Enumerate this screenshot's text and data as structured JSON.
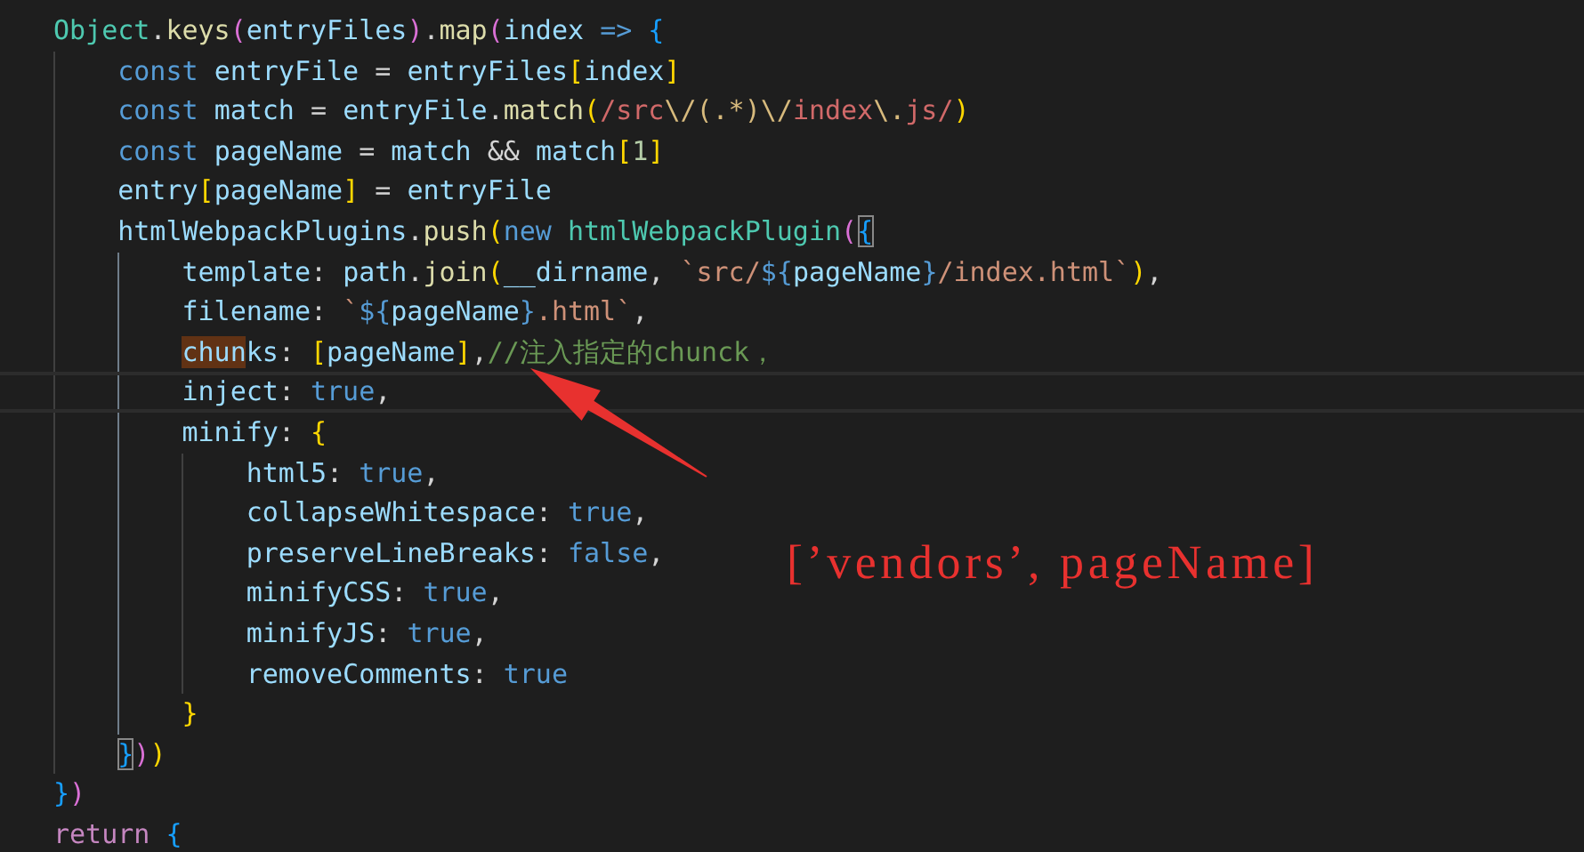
{
  "editor": {
    "lines": [
      {
        "current": false,
        "tokens": [
          {
            "text": "Object",
            "kind": "type"
          },
          {
            "text": ".",
            "kind": "plain"
          },
          {
            "text": "keys",
            "kind": "fn"
          },
          {
            "text": "(",
            "kind": "b2"
          },
          {
            "text": "entryFiles",
            "kind": "var"
          },
          {
            "text": ")",
            "kind": "b2"
          },
          {
            "text": ".",
            "kind": "plain"
          },
          {
            "text": "map",
            "kind": "fn"
          },
          {
            "text": "(",
            "kind": "b2"
          },
          {
            "text": "index",
            "kind": "var"
          },
          {
            "text": " => ",
            "kind": "kw"
          },
          {
            "text": "{",
            "kind": "b3"
          }
        ]
      },
      {
        "current": false,
        "tokens": [
          {
            "text": "    const",
            "kind": "kw"
          },
          {
            "text": " entryFile",
            "kind": "var"
          },
          {
            "text": " = ",
            "kind": "plain"
          },
          {
            "text": "entryFiles",
            "kind": "var"
          },
          {
            "text": "[",
            "kind": "b1"
          },
          {
            "text": "index",
            "kind": "var"
          },
          {
            "text": "]",
            "kind": "b1"
          }
        ]
      },
      {
        "current": false,
        "tokens": [
          {
            "text": "    const",
            "kind": "kw"
          },
          {
            "text": " match",
            "kind": "var"
          },
          {
            "text": " = ",
            "kind": "plain"
          },
          {
            "text": "entryFile",
            "kind": "var"
          },
          {
            "text": ".",
            "kind": "plain"
          },
          {
            "text": "match",
            "kind": "fn"
          },
          {
            "text": "(",
            "kind": "b1"
          },
          {
            "text": "/src",
            "kind": "regex"
          },
          {
            "text": "\\/(.*)\\/",
            "kind": "esc"
          },
          {
            "text": "index",
            "kind": "regex"
          },
          {
            "text": "\\.",
            "kind": "esc"
          },
          {
            "text": "js/",
            "kind": "regex"
          },
          {
            "text": ")",
            "kind": "b1"
          }
        ]
      },
      {
        "current": false,
        "tokens": [
          {
            "text": "    const",
            "kind": "kw"
          },
          {
            "text": " pageName",
            "kind": "var"
          },
          {
            "text": " = ",
            "kind": "plain"
          },
          {
            "text": "match",
            "kind": "var"
          },
          {
            "text": " && ",
            "kind": "plain"
          },
          {
            "text": "match",
            "kind": "var"
          },
          {
            "text": "[",
            "kind": "b1"
          },
          {
            "text": "1",
            "kind": "num"
          },
          {
            "text": "]",
            "kind": "b1"
          }
        ]
      },
      {
        "current": false,
        "tokens": [
          {
            "text": "    entry",
            "kind": "var"
          },
          {
            "text": "[",
            "kind": "b1"
          },
          {
            "text": "pageName",
            "kind": "var"
          },
          {
            "text": "]",
            "kind": "b1"
          },
          {
            "text": " = ",
            "kind": "plain"
          },
          {
            "text": "entryFile",
            "kind": "var"
          }
        ]
      },
      {
        "current": false,
        "tokens": [
          {
            "text": "    htmlWebpackPlugins",
            "kind": "var"
          },
          {
            "text": ".",
            "kind": "plain"
          },
          {
            "text": "push",
            "kind": "fn"
          },
          {
            "text": "(",
            "kind": "b1"
          },
          {
            "text": "new ",
            "kind": "kw"
          },
          {
            "text": "htmlWebpackPlugin",
            "kind": "type"
          },
          {
            "text": "(",
            "kind": "b2"
          },
          {
            "text": "{",
            "kind": "b3-match"
          }
        ]
      },
      {
        "current": false,
        "tokens": [
          {
            "text": "        template",
            "kind": "var"
          },
          {
            "text": ": ",
            "kind": "plain"
          },
          {
            "text": "path",
            "kind": "var"
          },
          {
            "text": ".",
            "kind": "plain"
          },
          {
            "text": "join",
            "kind": "fn"
          },
          {
            "text": "(",
            "kind": "b1"
          },
          {
            "text": "__dirname",
            "kind": "var"
          },
          {
            "text": ", ",
            "kind": "plain"
          },
          {
            "text": "`src/",
            "kind": "str"
          },
          {
            "text": "${",
            "kind": "kw"
          },
          {
            "text": "pageName",
            "kind": "var"
          },
          {
            "text": "}",
            "kind": "kw"
          },
          {
            "text": "/index.html`",
            "kind": "str"
          },
          {
            "text": ")",
            "kind": "b1"
          },
          {
            "text": ",",
            "kind": "plain"
          }
        ]
      },
      {
        "current": false,
        "tokens": [
          {
            "text": "        filename",
            "kind": "var"
          },
          {
            "text": ": ",
            "kind": "plain"
          },
          {
            "text": "`",
            "kind": "str"
          },
          {
            "text": "${",
            "kind": "kw"
          },
          {
            "text": "pageName",
            "kind": "var"
          },
          {
            "text": "}",
            "kind": "kw"
          },
          {
            "text": ".html`",
            "kind": "str"
          },
          {
            "text": ",",
            "kind": "plain"
          }
        ]
      },
      {
        "current": false,
        "tokens": [
          {
            "text": "        chun",
            "kind": "word-match"
          },
          {
            "text": "ks",
            "kind": "var"
          },
          {
            "text": ": ",
            "kind": "plain"
          },
          {
            "text": "[",
            "kind": "b1"
          },
          {
            "text": "pageName",
            "kind": "var"
          },
          {
            "text": "]",
            "kind": "b1"
          },
          {
            "text": ",",
            "kind": "plain"
          },
          {
            "text": "//注入指定的chunck，",
            "kind": "comment"
          }
        ]
      },
      {
        "current": true,
        "tokens": [
          {
            "text": "        inject",
            "kind": "var"
          },
          {
            "text": ": ",
            "kind": "plain"
          },
          {
            "text": "true",
            "kind": "kw"
          },
          {
            "text": ",",
            "kind": "plain"
          }
        ]
      },
      {
        "current": false,
        "tokens": [
          {
            "text": "        minify",
            "kind": "var"
          },
          {
            "text": ": ",
            "kind": "plain"
          },
          {
            "text": "{",
            "kind": "b1"
          }
        ]
      },
      {
        "current": false,
        "tokens": [
          {
            "text": "            html5",
            "kind": "var"
          },
          {
            "text": ": ",
            "kind": "plain"
          },
          {
            "text": "true",
            "kind": "kw"
          },
          {
            "text": ",",
            "kind": "plain"
          }
        ]
      },
      {
        "current": false,
        "tokens": [
          {
            "text": "            collapseWhitespace",
            "kind": "var"
          },
          {
            "text": ": ",
            "kind": "plain"
          },
          {
            "text": "true",
            "kind": "kw"
          },
          {
            "text": ",",
            "kind": "plain"
          }
        ]
      },
      {
        "current": false,
        "tokens": [
          {
            "text": "            preserveLineBreaks",
            "kind": "var"
          },
          {
            "text": ": ",
            "kind": "plain"
          },
          {
            "text": "false",
            "kind": "kw"
          },
          {
            "text": ",",
            "kind": "plain"
          }
        ]
      },
      {
        "current": false,
        "tokens": [
          {
            "text": "            minifyCSS",
            "kind": "var"
          },
          {
            "text": ": ",
            "kind": "plain"
          },
          {
            "text": "true",
            "kind": "kw"
          },
          {
            "text": ",",
            "kind": "plain"
          }
        ]
      },
      {
        "current": false,
        "tokens": [
          {
            "text": "            minifyJS",
            "kind": "var"
          },
          {
            "text": ": ",
            "kind": "plain"
          },
          {
            "text": "true",
            "kind": "kw"
          },
          {
            "text": ",",
            "kind": "plain"
          }
        ]
      },
      {
        "current": false,
        "tokens": [
          {
            "text": "            removeComments",
            "kind": "var"
          },
          {
            "text": ": ",
            "kind": "plain"
          },
          {
            "text": "true",
            "kind": "kw"
          }
        ]
      },
      {
        "current": false,
        "tokens": [
          {
            "text": "        }",
            "kind": "b1"
          }
        ]
      },
      {
        "current": false,
        "tokens": [
          {
            "text": "    }",
            "kind": "b3-match"
          },
          {
            "text": ")",
            "kind": "b2"
          },
          {
            "text": ")",
            "kind": "b1"
          }
        ]
      },
      {
        "current": false,
        "tokens": [
          {
            "text": "}",
            "kind": "b3"
          },
          {
            "text": ")",
            "kind": "b2"
          }
        ]
      },
      {
        "current": false,
        "tokens": [
          {
            "text": "return ",
            "kind": "ctrl"
          },
          {
            "text": "{",
            "kind": "b3"
          }
        ]
      }
    ]
  },
  "annotation": {
    "text": "[’vendors’, pageName]"
  }
}
